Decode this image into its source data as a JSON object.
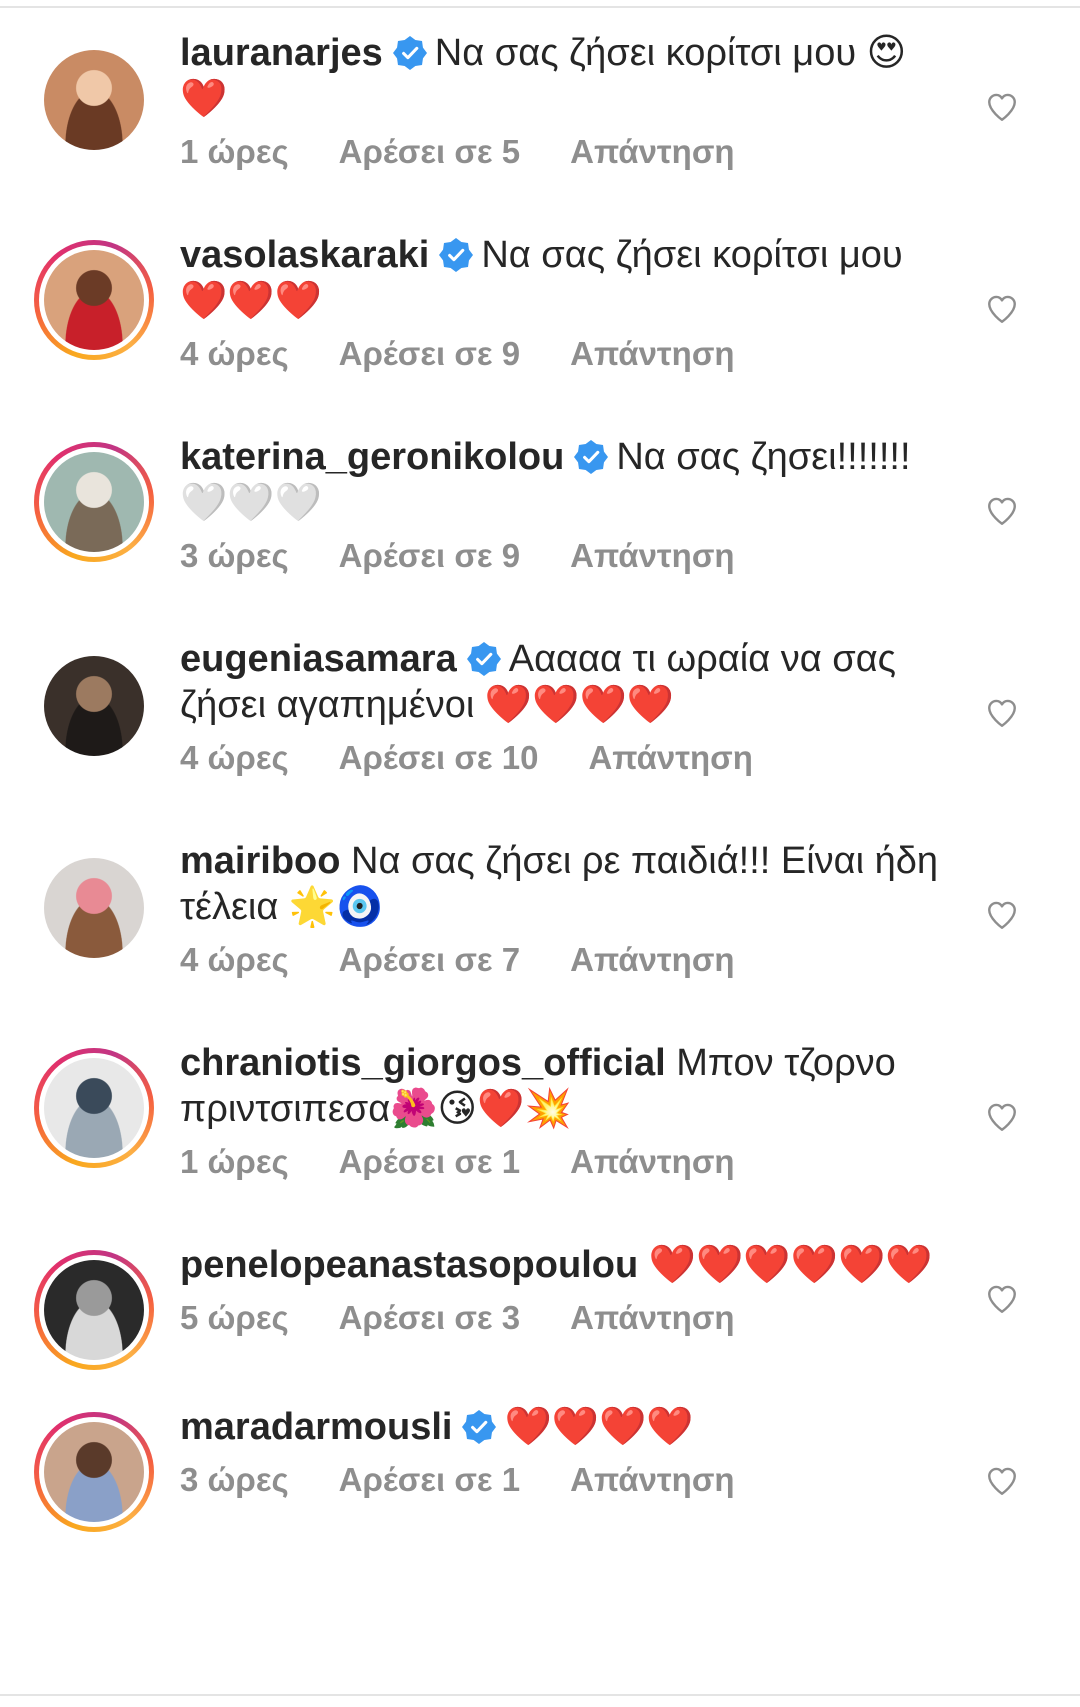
{
  "comments": [
    {
      "username": "lauranarjes",
      "verified": true,
      "story": false,
      "text": "Να σας ζήσει κορίτσι μου 😍 ❤️",
      "time": "1 ώρες",
      "likes": "Αρέσει σε 5",
      "reply": "Απάντηση",
      "avatar_colors": [
        "#c98b64",
        "#f0c8a8",
        "#6a3a24"
      ]
    },
    {
      "username": "vasolaskaraki",
      "verified": true,
      "story": true,
      "text": "Να σας ζήσει κορίτσι μου ❤️❤️❤️",
      "time": "4 ώρες",
      "likes": "Αρέσει σε 9",
      "reply": "Απάντηση",
      "avatar_colors": [
        "#d9a27c",
        "#6b3b26",
        "#c8202a"
      ]
    },
    {
      "username": "katerina_geronikolou",
      "verified": true,
      "story": true,
      "text": "Να σας ζησει!!!!!!! 🤍🤍🤍",
      "time": "3 ώρες",
      "likes": "Αρέσει σε 9",
      "reply": "Απάντηση",
      "avatar_colors": [
        "#9fb8b0",
        "#e9e4dc",
        "#7a6a58"
      ]
    },
    {
      "username": "eugeniasamara",
      "verified": true,
      "story": false,
      "text": "Ααααα τι ωραία να σας ζήσει αγαπημένοι ❤️❤️❤️❤️",
      "time": "4 ώρες",
      "likes": "Αρέσει σε 10",
      "reply": "Απάντηση",
      "avatar_colors": [
        "#3a302a",
        "#9c7a60",
        "#1e1a18"
      ]
    },
    {
      "username": "mairiboo",
      "verified": false,
      "story": false,
      "text": "Να σας ζήσει ρε παιδιά!!! Είναι ήδη τέλεια 🌟🧿",
      "time": "4 ώρες",
      "likes": "Αρέσει σε 7",
      "reply": "Απάντηση",
      "avatar_colors": [
        "#d9d5d2",
        "#e88a94",
        "#8a5a3c"
      ]
    },
    {
      "username": "chraniotis_giorgos_official",
      "verified": false,
      "story": true,
      "text": "Μπον τζορνο πριντσιπεσα🌺😘❤️💥",
      "time": "1 ώρες",
      "likes": "Αρέσει σε 1",
      "reply": "Απάντηση",
      "avatar_colors": [
        "#e8e8e8",
        "#3a4a5a",
        "#9aa8b4"
      ]
    },
    {
      "username": "penelopeanastasopoulou",
      "verified": false,
      "story": true,
      "text": "❤️❤️❤️❤️❤️❤️",
      "time": "5 ώρες",
      "likes": "Αρέσει σε 3",
      "reply": "Απάντηση",
      "avatar_colors": [
        "#2a2a2a",
        "#9a9a9a",
        "#d8d8d8"
      ]
    },
    {
      "username": "maradarmousli",
      "verified": true,
      "story": true,
      "text": "❤️❤️❤️❤️",
      "time": "3 ώρες",
      "likes": "Αρέσει σε 1",
      "reply": "Απάντηση",
      "avatar_colors": [
        "#c9a48c",
        "#5a3a2a",
        "#8aa0c8"
      ]
    }
  ],
  "colors": {
    "verified": "#3897f0",
    "meta": "#8e8e8e",
    "text": "#262626"
  },
  "icons": {
    "verified": "verified-badge-icon",
    "like": "heart-outline-icon"
  }
}
